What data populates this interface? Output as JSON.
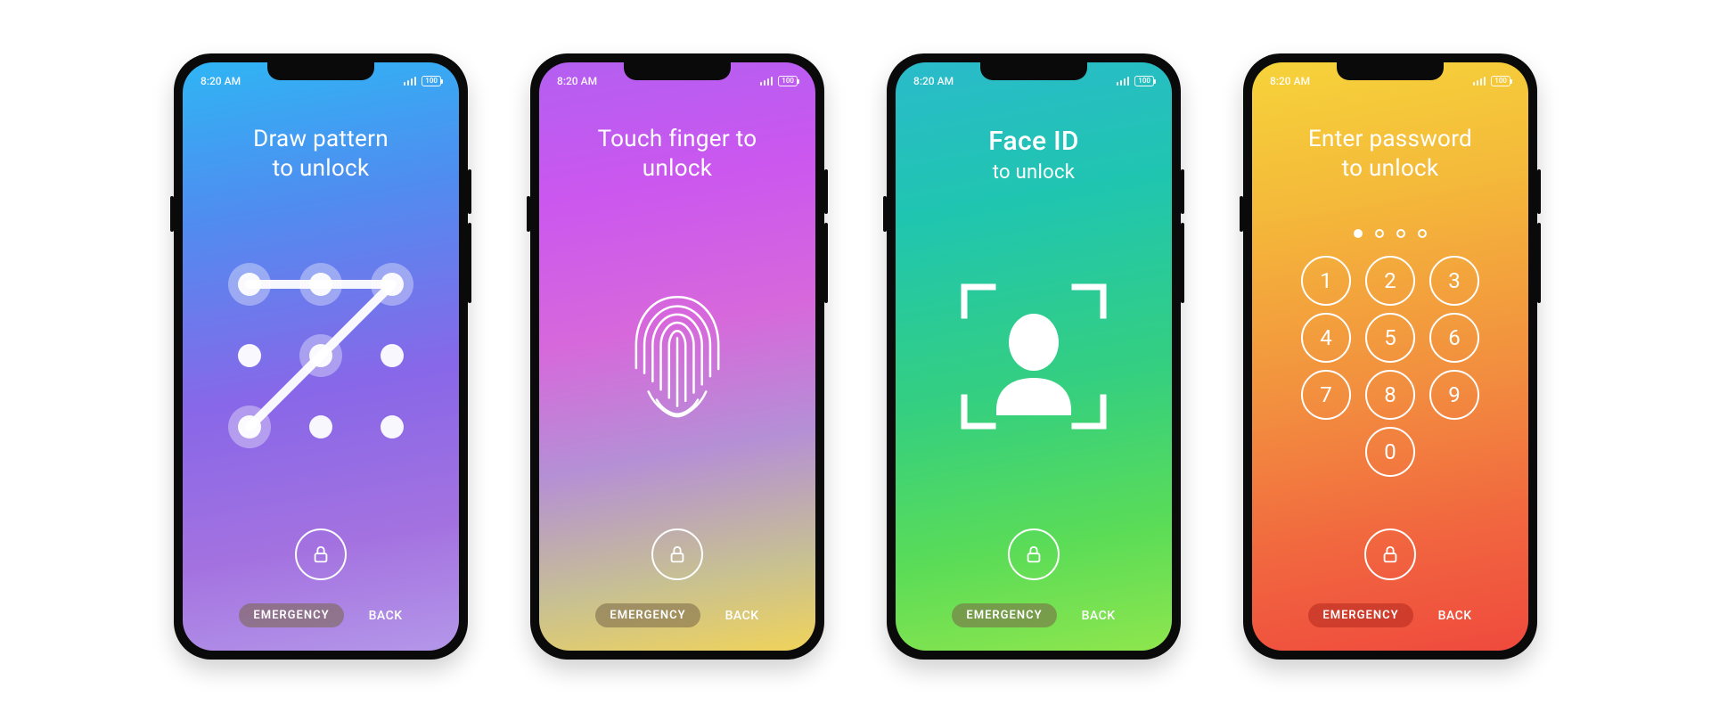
{
  "status": {
    "time": "8:20 AM",
    "battery_text": "100"
  },
  "footer": {
    "emergency": "EMERGENCY",
    "back": "BACK"
  },
  "lock_icon": "lock-icon",
  "screens": [
    {
      "id": "pattern",
      "title_line1": "Draw pattern",
      "title_line2": "to unlock",
      "pattern_active_dots": [
        0,
        1,
        2,
        4,
        6
      ],
      "pattern_path": "M25,25 L105,25 L185,25 L105,105 L25,185"
    },
    {
      "id": "fingerprint",
      "title_line1": "Touch finger to",
      "title_line2": "unlock"
    },
    {
      "id": "faceid",
      "title_big": "Face ID",
      "title_sub": "to unlock"
    },
    {
      "id": "password",
      "title_line1": "Enter password",
      "title_line2": "to unlock",
      "entered_count": 1,
      "total_dots": 4,
      "keys": [
        "1",
        "2",
        "3",
        "4",
        "5",
        "6",
        "7",
        "8",
        "9",
        "0"
      ]
    }
  ]
}
